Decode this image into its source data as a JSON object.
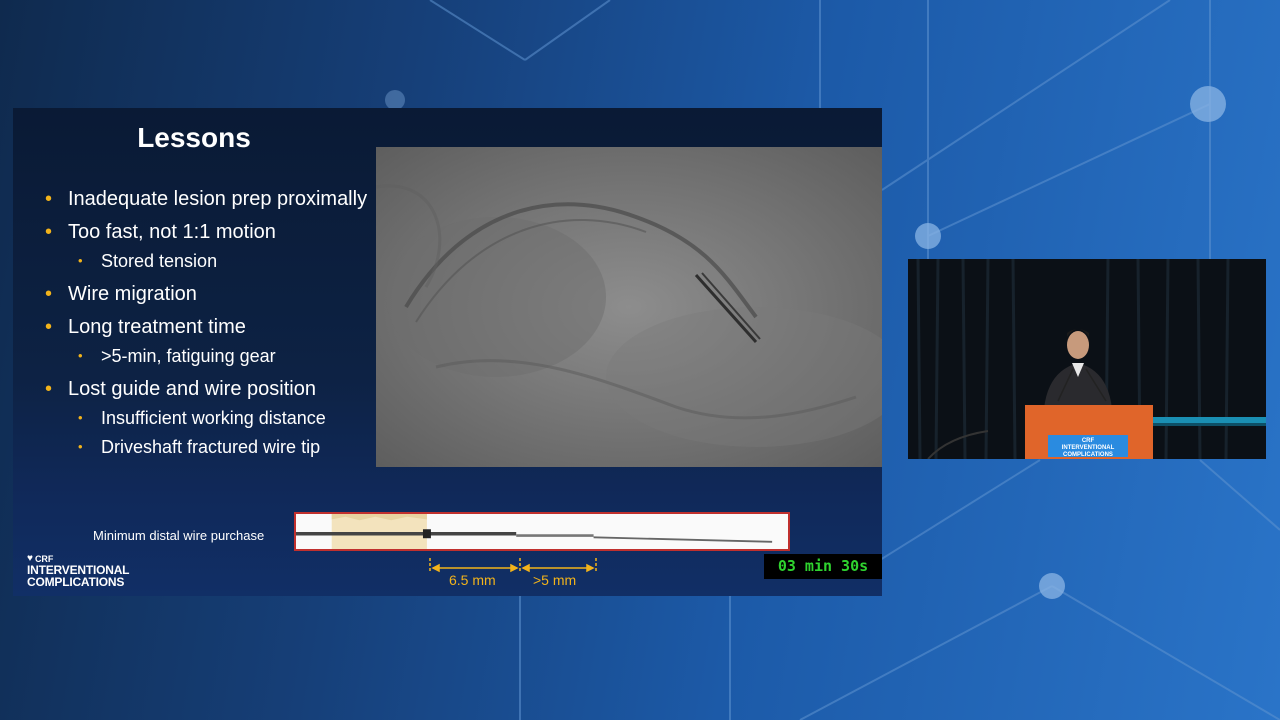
{
  "slide": {
    "title": "Lessons",
    "bullets": [
      {
        "text": "Inadequate lesion prep proximally",
        "sub": []
      },
      {
        "text": "Too fast, not 1:1 motion",
        "sub": [
          "Stored tension"
        ]
      },
      {
        "text": "Wire migration",
        "sub": []
      },
      {
        "text": "Long treatment time",
        "sub": [
          ">5-min, fatiguing gear"
        ]
      },
      {
        "text": "Lost guide and wire position",
        "sub": [
          "Insufficient working distance",
          "Driveshaft fractured wire tip"
        ]
      }
    ],
    "wire_caption": "Minimum distal wire purchase",
    "measurement_1": "6.5 mm",
    "measurement_2": ">5 mm",
    "logo": {
      "crf": "CRF",
      "line1": "INTERVENTIONAL",
      "line2": "COMPLICATIONS"
    }
  },
  "timer": "03 min 30s",
  "podium_sign": {
    "crf": "CRF",
    "line1": "INTERVENTIONAL",
    "line2": "COMPLICATIONS"
  },
  "colors": {
    "bullet_accent": "#f2b31b",
    "timer_text": "#2fd32f",
    "wire_border": "#c0302e"
  },
  "icons": {
    "logo": "heart-crf-logo-icon"
  }
}
